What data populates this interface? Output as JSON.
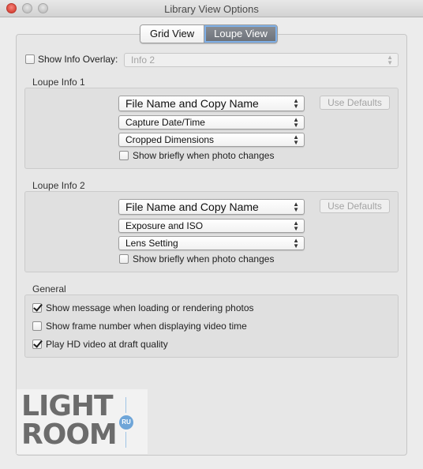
{
  "window": {
    "title": "Library View Options"
  },
  "tabs": [
    {
      "label": "Grid View"
    },
    {
      "label": "Loupe View"
    }
  ],
  "overlay": {
    "label": "Show Info Overlay:",
    "checked": false,
    "select_value": "Info 2"
  },
  "loupe_info_1": {
    "title": "Loupe Info 1",
    "field1": "File Name and Copy Name",
    "field2": "Capture Date/Time",
    "field3": "Cropped Dimensions",
    "use_defaults": "Use Defaults",
    "show_briefly": "Show briefly when photo changes"
  },
  "loupe_info_2": {
    "title": "Loupe Info 2",
    "field1": "File Name and Copy Name",
    "field2": "Exposure and ISO",
    "field3": "Lens Setting",
    "use_defaults": "Use Defaults",
    "show_briefly": "Show briefly when photo changes"
  },
  "general": {
    "title": "General",
    "options": [
      {
        "label": "Show message when loading or rendering photos",
        "checked": true
      },
      {
        "label": "Show frame number when displaying video time",
        "checked": false
      },
      {
        "label": "Play HD video at draft quality",
        "checked": true
      }
    ]
  },
  "watermark": {
    "line1": "LIGHT",
    "line2": "ROOM",
    "badge": "RU"
  },
  "colors": {
    "accent": "#6ea5d8",
    "window_bg": "#ececec",
    "close_button": "#d9463a"
  },
  "icons": {
    "popup": "updown-arrows-icon",
    "check": "checkmark-icon"
  }
}
